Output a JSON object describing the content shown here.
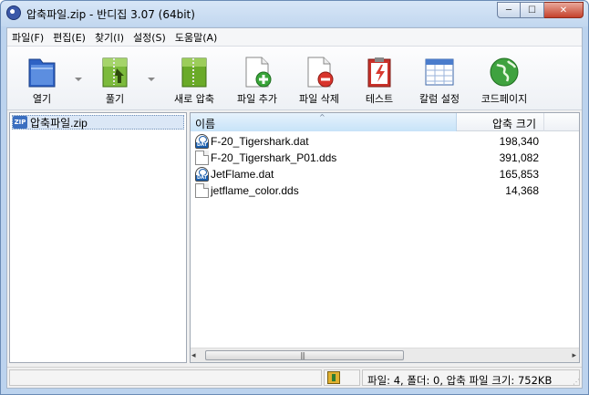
{
  "window": {
    "title": "압축파일.zip - 반디집 3.07 (64bit)",
    "controls": {
      "minimize": "─",
      "maximize": "☐",
      "close": "✕"
    }
  },
  "menu": [
    "파일(F)",
    "편집(E)",
    "찾기(I)",
    "설정(S)",
    "도움말(A)"
  ],
  "toolbar": [
    {
      "label": "열기",
      "icon": "folder-open-icon",
      "has_dropdown": true
    },
    {
      "label": "풀기",
      "icon": "extract-icon",
      "has_dropdown": true
    },
    {
      "label": "새로 압축",
      "icon": "new-archive-icon",
      "has_dropdown": false
    },
    {
      "label": "파일 추가",
      "icon": "add-file-icon",
      "has_dropdown": false
    },
    {
      "label": "파일 삭제",
      "icon": "delete-file-icon",
      "has_dropdown": false
    },
    {
      "label": "테스트",
      "icon": "test-clipboard-icon",
      "has_dropdown": false
    },
    {
      "label": "칼럼 설정",
      "icon": "column-settings-icon",
      "has_dropdown": false
    },
    {
      "label": "코드페이지",
      "icon": "globe-icon",
      "has_dropdown": false
    }
  ],
  "tree": {
    "items": [
      {
        "label": "압축파일.zip",
        "icon": "zip-archive-icon",
        "selected": true
      }
    ]
  },
  "list": {
    "columns": {
      "name": "이름",
      "size": "압축 크기"
    },
    "rows": [
      {
        "name": "F-20_Tigershark.dat",
        "size": "198,340",
        "icon": "dat-file-icon"
      },
      {
        "name": "F-20_Tigershark_P01.dds",
        "size": "391,082",
        "icon": "document-icon"
      },
      {
        "name": "JetFlame.dat",
        "size": "165,853",
        "icon": "dat-file-icon"
      },
      {
        "name": "jetflame_color.dds",
        "size": "14,368",
        "icon": "document-icon"
      }
    ],
    "scroll": {
      "left_arrow": "◂",
      "right_arrow": "▸",
      "grip": "|||"
    }
  },
  "status": {
    "text": "파일: 4, 폴더: 0, 압축 파일 크기: 752KB"
  },
  "colors": {
    "accent": "#c7e3f8",
    "title_bg": "#c2d7ef",
    "close": "#c5412b"
  }
}
